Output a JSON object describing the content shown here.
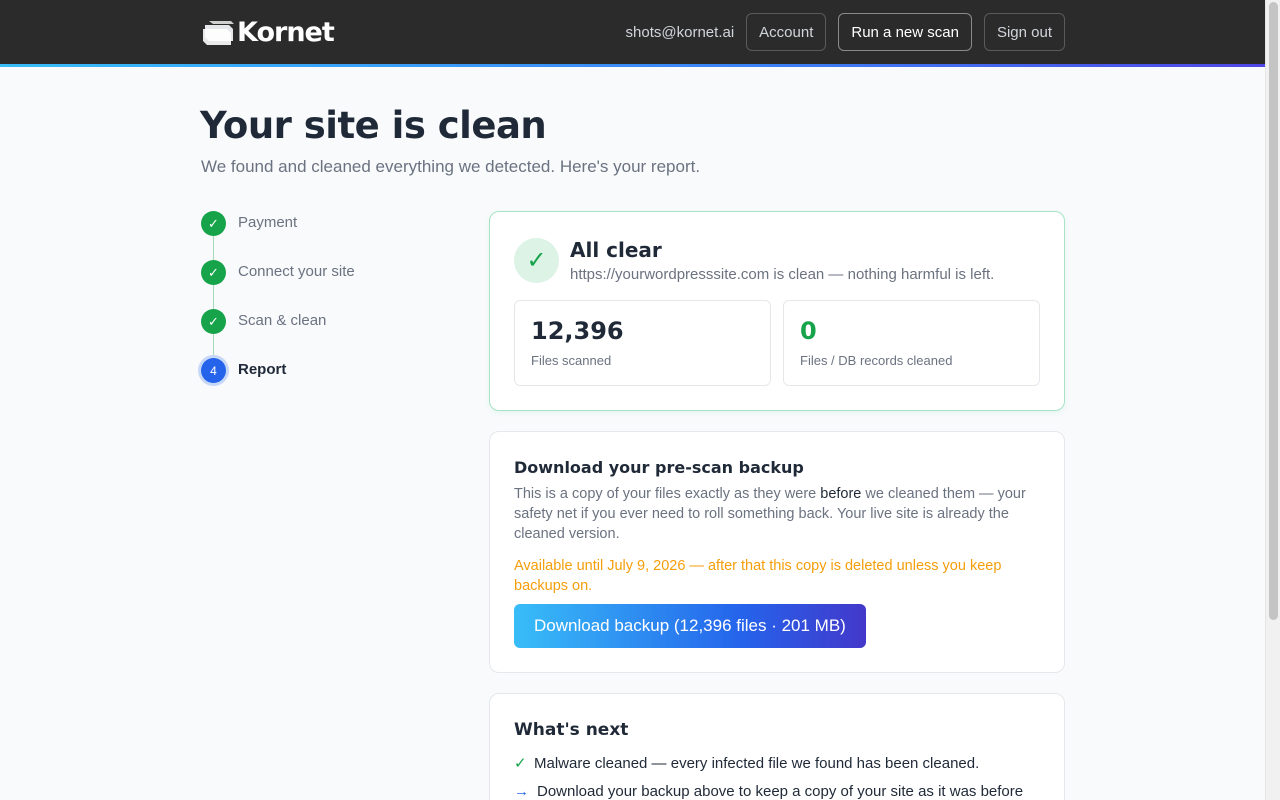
{
  "header": {
    "brand": "Kornet",
    "email": "shots@kornet.ai",
    "account_label": "Account",
    "new_scan_label": "Run a new scan",
    "sign_out_label": "Sign out"
  },
  "page": {
    "title": "Your site is clean",
    "subtitle": "We found and cleaned everything we detected. Here's your report."
  },
  "steps": [
    {
      "label": "Payment",
      "status": "done",
      "marker": "✓"
    },
    {
      "label": "Connect your site",
      "status": "done",
      "marker": "✓"
    },
    {
      "label": "Scan & clean",
      "status": "done",
      "marker": "✓"
    },
    {
      "label": "Report",
      "status": "current",
      "marker": "4"
    }
  ],
  "result": {
    "title": "All clear",
    "subtitle": "https://yourwordpresssite.com is clean — nothing harmful is left.",
    "stats": [
      {
        "value": "12,396",
        "label": "Files scanned"
      },
      {
        "value": "0",
        "label": "Files / DB records cleaned"
      }
    ]
  },
  "backup": {
    "title": "Download your pre-scan backup",
    "desc_before": "This is a copy of your files exactly as they were ",
    "desc_emph": "before",
    "desc_after": " we cleaned them — your safety net if you ever need to roll something back. Your live site is already the cleaned version.",
    "warning": "Available until July 9, 2026 — after that this copy is deleted unless you keep backups on.",
    "button_label": "Download backup (12,396 files · 201 MB)"
  },
  "next": {
    "title": "What's next",
    "items": [
      {
        "marker": "✓",
        "text": "Malware cleaned — every infected file we found has been cleaned."
      },
      {
        "marker": "→",
        "text": "Download your backup above to keep a copy of your site as it was before"
      }
    ]
  },
  "colors": {
    "topbar": "#2b2b2b",
    "success": "#16a34a",
    "accent": "#2563eb",
    "warning": "#f59e0b"
  }
}
